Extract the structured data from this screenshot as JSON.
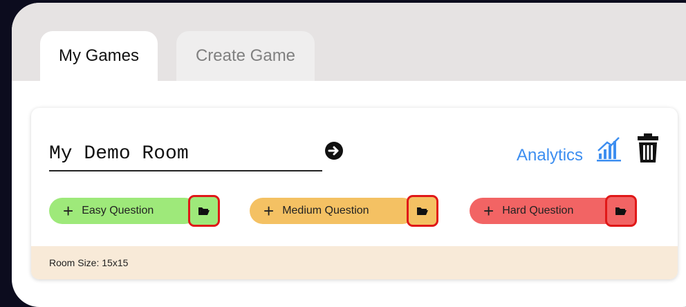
{
  "tabs": [
    {
      "label": "My Games",
      "active": true
    },
    {
      "label": "Create Game",
      "active": false
    }
  ],
  "room": {
    "name": "My Demo Room",
    "go_icon": "arrow-right-circle-icon",
    "analytics_label": "Analytics",
    "analytics_icon": "bar-chart-icon",
    "delete_icon": "trash-icon",
    "questions": [
      {
        "label": "Easy Question",
        "color": "#9ee97a",
        "icon": "folder-open-icon"
      },
      {
        "label": "Medium Question",
        "color": "#f4c163",
        "icon": "folder-open-icon"
      },
      {
        "label": "Hard Question",
        "color": "#f26464",
        "icon": "folder-open-icon"
      }
    ],
    "size_text": "Room Size: 15x15"
  },
  "colors": {
    "accent": "#3d8ef0",
    "highlight": "#e01818",
    "footer_bg": "#f8ead8"
  }
}
